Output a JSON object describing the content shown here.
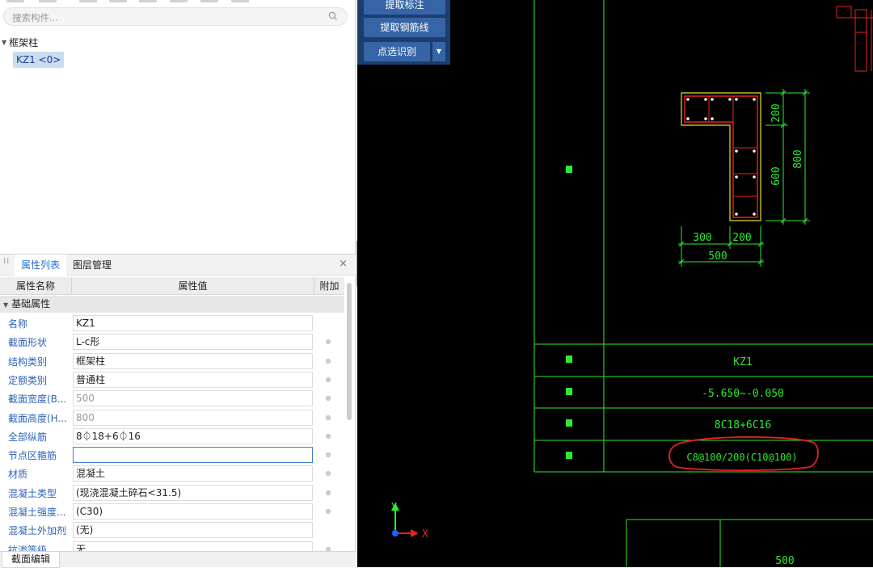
{
  "search": {
    "placeholder": "搜索构件..."
  },
  "tree": {
    "parent": "框架柱",
    "child": "KZ1 <0>"
  },
  "panel": {
    "tab_properties": "属性列表",
    "tab_layers": "图层管理",
    "close": "×",
    "header": {
      "name": "属性名称",
      "value": "属性值",
      "extra": "附加"
    },
    "group": "基础属性",
    "rows": [
      {
        "name": "名称",
        "value": "KZ1"
      },
      {
        "name": "截面形状",
        "value": "L-c形"
      },
      {
        "name": "结构类别",
        "value": "框架柱"
      },
      {
        "name": "定额类别",
        "value": "普通柱"
      },
      {
        "name": "截面宽度(B...",
        "value": "500"
      },
      {
        "name": "截面高度(H...",
        "value": "800"
      },
      {
        "name": "全部纵筋",
        "value": "8⏀18+6⏀16"
      },
      {
        "name": "节点区箍筋",
        "value": ""
      },
      {
        "name": "材质",
        "value": "混凝土"
      },
      {
        "name": "混凝土类型",
        "value": "(现浇混凝土碎石<31.5)"
      },
      {
        "name": "混凝土强度...",
        "value": "(C30)"
      },
      {
        "name": "混凝土外加剂",
        "value": "(无)"
      },
      {
        "name": "抗渗等级",
        "value": "无"
      }
    ]
  },
  "bottom_tab": "截面编辑",
  "tools": {
    "btn1": "提取标注",
    "btn2": "提取钢筋线",
    "btn3": "点选识别"
  },
  "cad": {
    "dim_300": "300",
    "dim_200_bottom": "200",
    "dim_500": "500",
    "dim_200_right": "200",
    "dim_600": "600",
    "dim_800": "800",
    "table_id": "KZ1",
    "table_elev": "-5.650~-0.050",
    "table_bars": "8C18+6C16",
    "table_stirrup": "C8@100/200(C10@100)",
    "bottom_500": "500",
    "axis_x": "X",
    "axis_y": "Y"
  },
  "colors": {
    "accent": "#2a6fd1",
    "cad_green": "#2eea2e",
    "highlight_red": "#e82020",
    "column_yellow": "#e8e020"
  }
}
